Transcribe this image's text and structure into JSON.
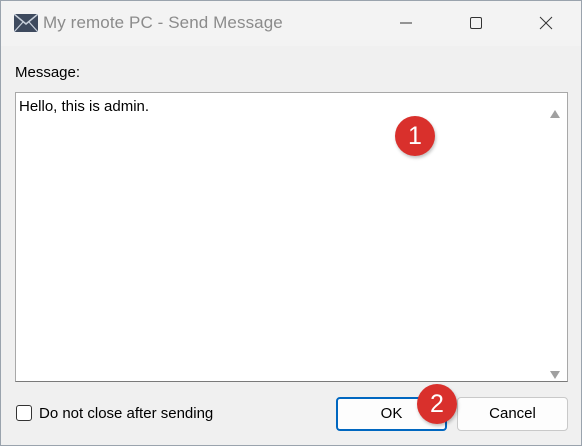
{
  "window": {
    "title": "My remote PC - Send Message",
    "app_icon": "envelope-icon",
    "controls": [
      "minimize-icon",
      "maximize-icon",
      "close-icon"
    ]
  },
  "message": {
    "label": "Message:",
    "value": "Hello, this is admin."
  },
  "annotations": [
    "1",
    "2"
  ],
  "footer": {
    "checkbox_label": "Do not close after sending",
    "checkbox_checked": false,
    "ok_label": "OK",
    "cancel_label": "Cancel"
  },
  "colors": {
    "accent": "#0067c0",
    "badge": "#d9302c"
  }
}
